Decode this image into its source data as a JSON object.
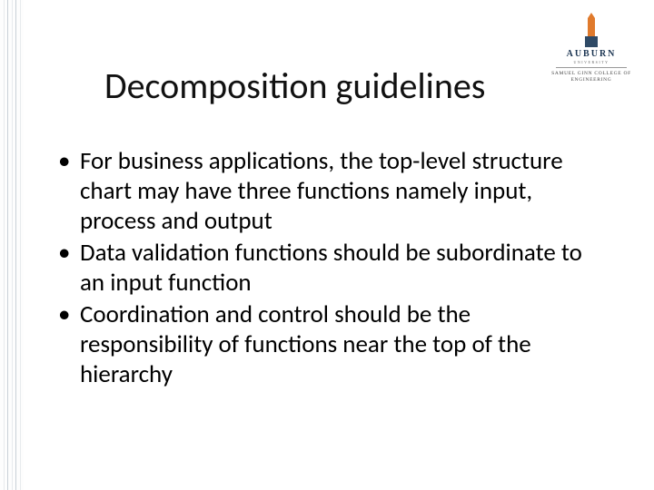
{
  "logo": {
    "name": "AUBURN",
    "sub1": "UNIVERSITY",
    "sub2": "SAMUEL GINN COLLEGE OF ENGINEERING"
  },
  "title": "Decomposition guidelines",
  "bullets": [
    "For business applications, the top-level structure chart may have three functions namely input, process and output",
    "Data validation functions should be subordinate to an input function",
    "Coordination and control should be the responsibility of functions near the top of the hierarchy"
  ]
}
